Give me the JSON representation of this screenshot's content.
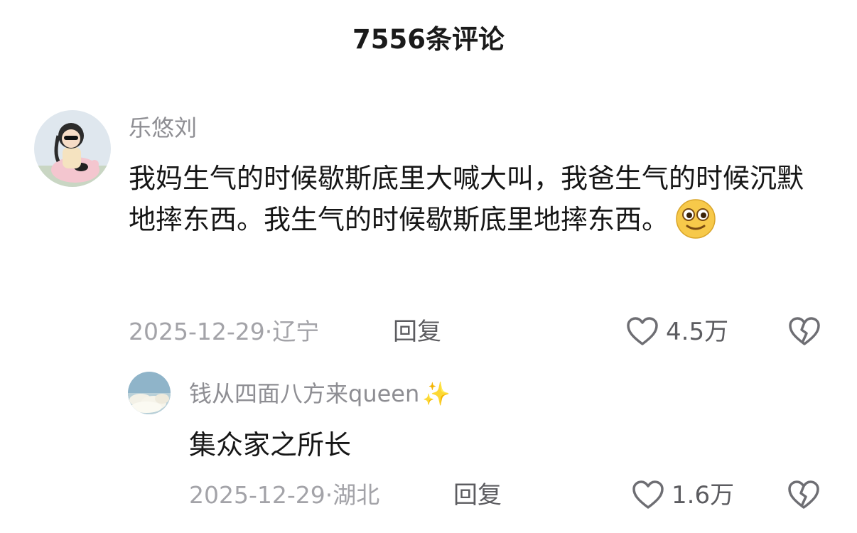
{
  "header": {
    "title": "7556条评论"
  },
  "comments": [
    {
      "avatar_icon": "user-avatar-girl-on-pig",
      "username": "乐悠刘",
      "text": "我妈生气的时候歇斯底里大喊大叫，我爸生气的时候沉默地摔东西。我生气的时候歇斯底里地摔东西。",
      "emoji_icon": "smiling-face-emoji",
      "date_location": "2025-12-29·辽宁",
      "reply_label": "回复",
      "likes": "4.5万",
      "replies": [
        {
          "avatar_icon": "user-avatar-sky-clouds",
          "username": "钱从四面八方来queen",
          "username_suffix": "✨",
          "text": "集众家之所长",
          "date_location": "2025-12-29·湖北",
          "reply_label": "回复",
          "likes": "1.6万"
        }
      ]
    }
  ],
  "colors": {
    "primary_text": "#161616",
    "secondary_text": "#8e8e93",
    "action_text": "#5c5c60",
    "sparkle": "#f2c94c"
  }
}
